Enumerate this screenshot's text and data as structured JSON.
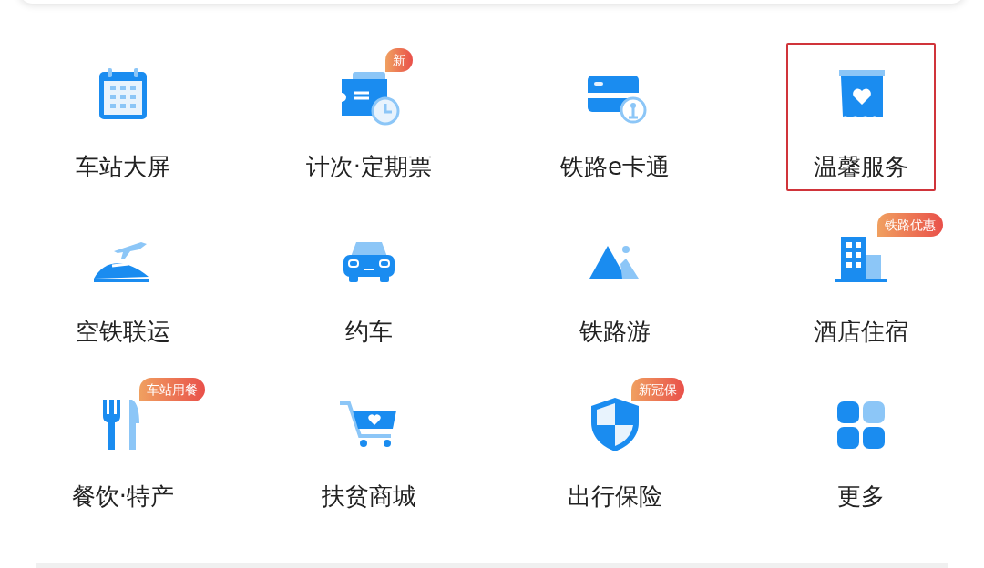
{
  "services": [
    {
      "label": "车站大屏",
      "highlighted": false
    },
    {
      "label": "计次·定期票",
      "badge": "新",
      "highlighted": false
    },
    {
      "label": "铁路e卡通",
      "highlighted": false
    },
    {
      "label": "温馨服务",
      "highlighted": true
    },
    {
      "label": "空铁联运",
      "highlighted": false
    },
    {
      "label": "约车",
      "highlighted": false
    },
    {
      "label": "铁路游",
      "highlighted": false
    },
    {
      "label": "酒店住宿",
      "badge": "铁路优惠",
      "highlighted": false
    },
    {
      "label": "餐饮·特产",
      "badge": "车站用餐",
      "highlighted": false
    },
    {
      "label": "扶贫商城",
      "highlighted": false
    },
    {
      "label": "出行保险",
      "badge": "新冠保",
      "highlighted": false
    },
    {
      "label": "更多",
      "highlighted": false
    }
  ]
}
